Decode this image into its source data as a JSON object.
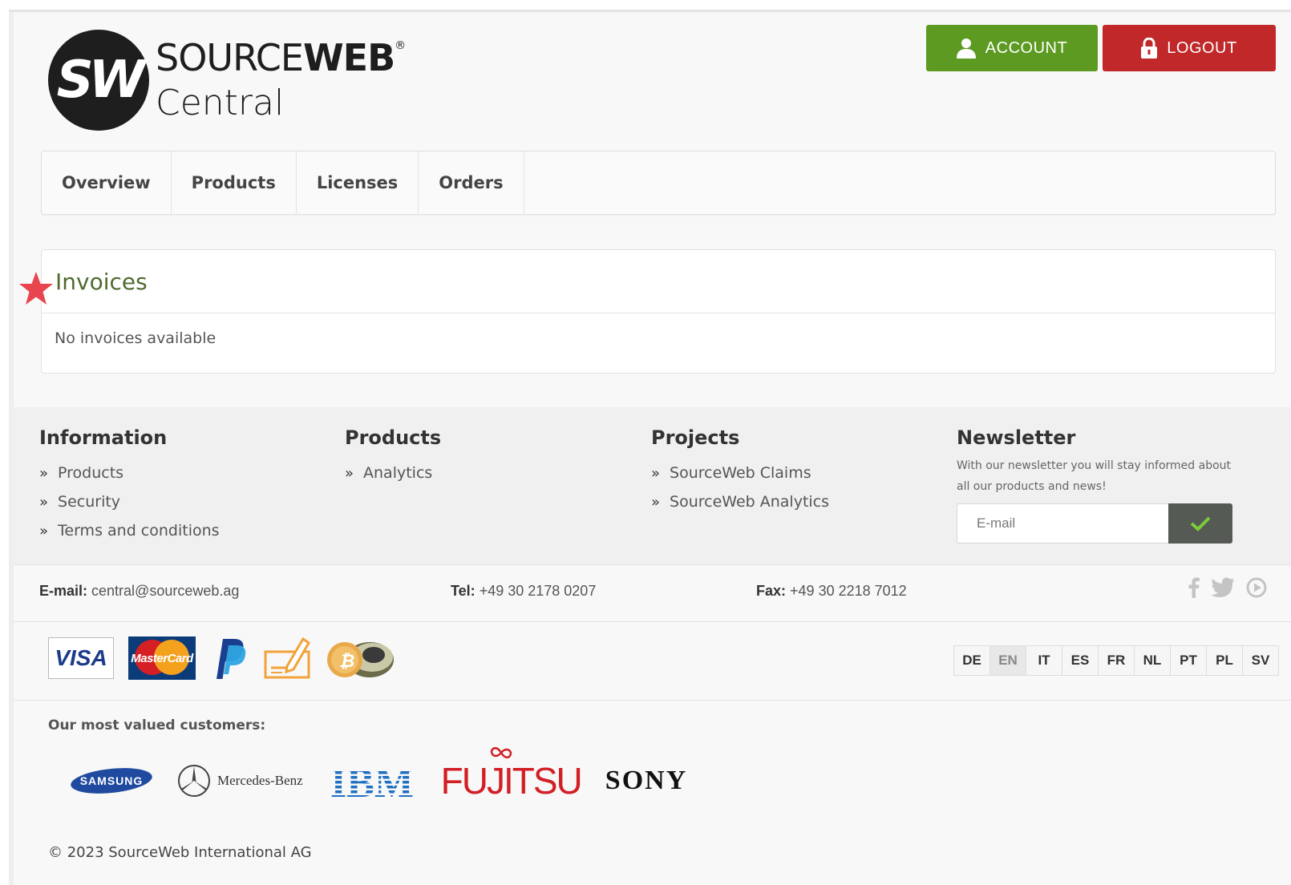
{
  "header": {
    "logo": {
      "brand_light": "SOURCE",
      "brand_bold": "WEB",
      "registered": "®",
      "sub": "Central",
      "monogram": "SW"
    },
    "account_label": "ACCOUNT",
    "logout_label": "LOGOUT",
    "account_color": "#5d9a22",
    "logout_color": "#c0282a"
  },
  "nav": {
    "items": [
      {
        "label": "Overview"
      },
      {
        "label": "Products"
      },
      {
        "label": "Licenses"
      },
      {
        "label": "Orders"
      }
    ]
  },
  "invoices": {
    "title": "Invoices",
    "empty_message": "No invoices available"
  },
  "footer": {
    "information": {
      "title": "Information",
      "links": [
        "Products",
        "Security",
        "Terms and conditions"
      ]
    },
    "products": {
      "title": "Products",
      "links": [
        "Analytics"
      ]
    },
    "projects": {
      "title": "Projects",
      "links": [
        "SourceWeb Claims",
        "SourceWeb Analytics"
      ]
    },
    "newsletter": {
      "title": "Newsletter",
      "text": "With our newsletter you will stay informed about all our products and news!",
      "placeholder": "E-mail"
    },
    "contact": {
      "email_label": "E-mail:",
      "email": "central@sourceweb.ag",
      "tel_label": "Tel:",
      "tel": "+49 30 2178 0207",
      "fax_label": "Fax:",
      "fax": "+49 30 2218 7012"
    },
    "social": [
      "facebook-icon",
      "twitter-icon",
      "youtube-icon"
    ],
    "payments": {
      "visa": "VISA",
      "mastercard": "MasterCard",
      "icons": [
        "visa-icon",
        "mastercard-icon",
        "paypal-icon",
        "check-icon",
        "bitcoin-icon"
      ]
    },
    "languages": [
      "DE",
      "EN",
      "IT",
      "ES",
      "FR",
      "NL",
      "PT",
      "PL",
      "SV"
    ],
    "active_language": "EN",
    "customers_label": "Our most valued customers:",
    "customers": [
      "SAMSUNG",
      "Mercedes-Benz",
      "IBM",
      "FUJITSU",
      "SONY"
    ],
    "copyright": "© 2023 SourceWeb International AG"
  }
}
